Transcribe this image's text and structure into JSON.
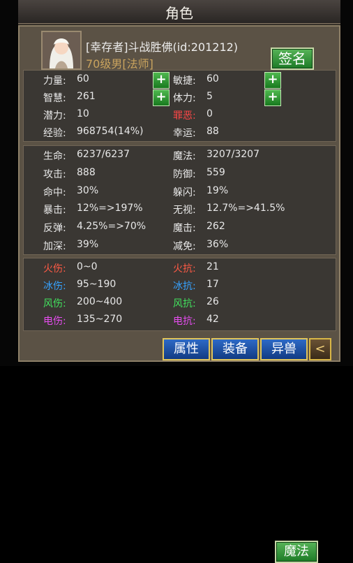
{
  "title": "角色",
  "player": {
    "name": "[幸存者]斗战胜佛(id:201212)",
    "info": "70级男[法师]"
  },
  "buttons": {
    "sign": "签名",
    "magic": "魔法",
    "plus": "+",
    "back": "<"
  },
  "primary": [
    {
      "label": "力量:",
      "value": "60",
      "plus": true
    },
    {
      "label": "敏捷:",
      "value": "60",
      "plus": true
    },
    {
      "label": "智慧:",
      "value": "261",
      "plus": true
    },
    {
      "label": "体力:",
      "value": "5",
      "plus": true
    },
    {
      "label": "潜力:",
      "value": "10",
      "plus": false
    },
    {
      "label": "罪恶:",
      "value": "0",
      "plus": false,
      "label_color": "#ff4747"
    },
    {
      "label": "经验:",
      "value": "968754(14%)",
      "plus": false
    },
    {
      "label": "幸运:",
      "value": "88",
      "plus": false
    }
  ],
  "combat": [
    {
      "label": "生命:",
      "value": "6237/6237"
    },
    {
      "label": "魔法:",
      "value": "3207/3207"
    },
    {
      "label": "攻击:",
      "value": "888"
    },
    {
      "label": "防御:",
      "value": "559"
    },
    {
      "label": "命中:",
      "value": "30%"
    },
    {
      "label": "躲闪:",
      "value": "19%"
    },
    {
      "label": "暴击:",
      "value": "12%=>197%"
    },
    {
      "label": "无视:",
      "value": "12.7%=>41.5%"
    },
    {
      "label": "反弹:",
      "value": "4.25%=>70%"
    },
    {
      "label": "魔击:",
      "value": "262"
    },
    {
      "label": "加深:",
      "value": "39%"
    },
    {
      "label": "减免:",
      "value": "36%"
    }
  ],
  "elements": [
    {
      "label": "火伤:",
      "value": "0~0",
      "color": "#ff5a45"
    },
    {
      "label": "火抗:",
      "value": "21",
      "color": "#ff5a45"
    },
    {
      "label": "冰伤:",
      "value": "95~190",
      "color": "#36a2ff"
    },
    {
      "label": "冰抗:",
      "value": "17",
      "color": "#36a2ff"
    },
    {
      "label": "风伤:",
      "value": "200~400",
      "color": "#42e25e"
    },
    {
      "label": "风抗:",
      "value": "26",
      "color": "#42e25e"
    },
    {
      "label": "电伤:",
      "value": "135~270",
      "color": "#e64df0"
    },
    {
      "label": "电抗:",
      "value": "42",
      "color": "#e64df0"
    }
  ],
  "bottom_tabs": [
    "属性",
    "装备",
    "异兽"
  ]
}
